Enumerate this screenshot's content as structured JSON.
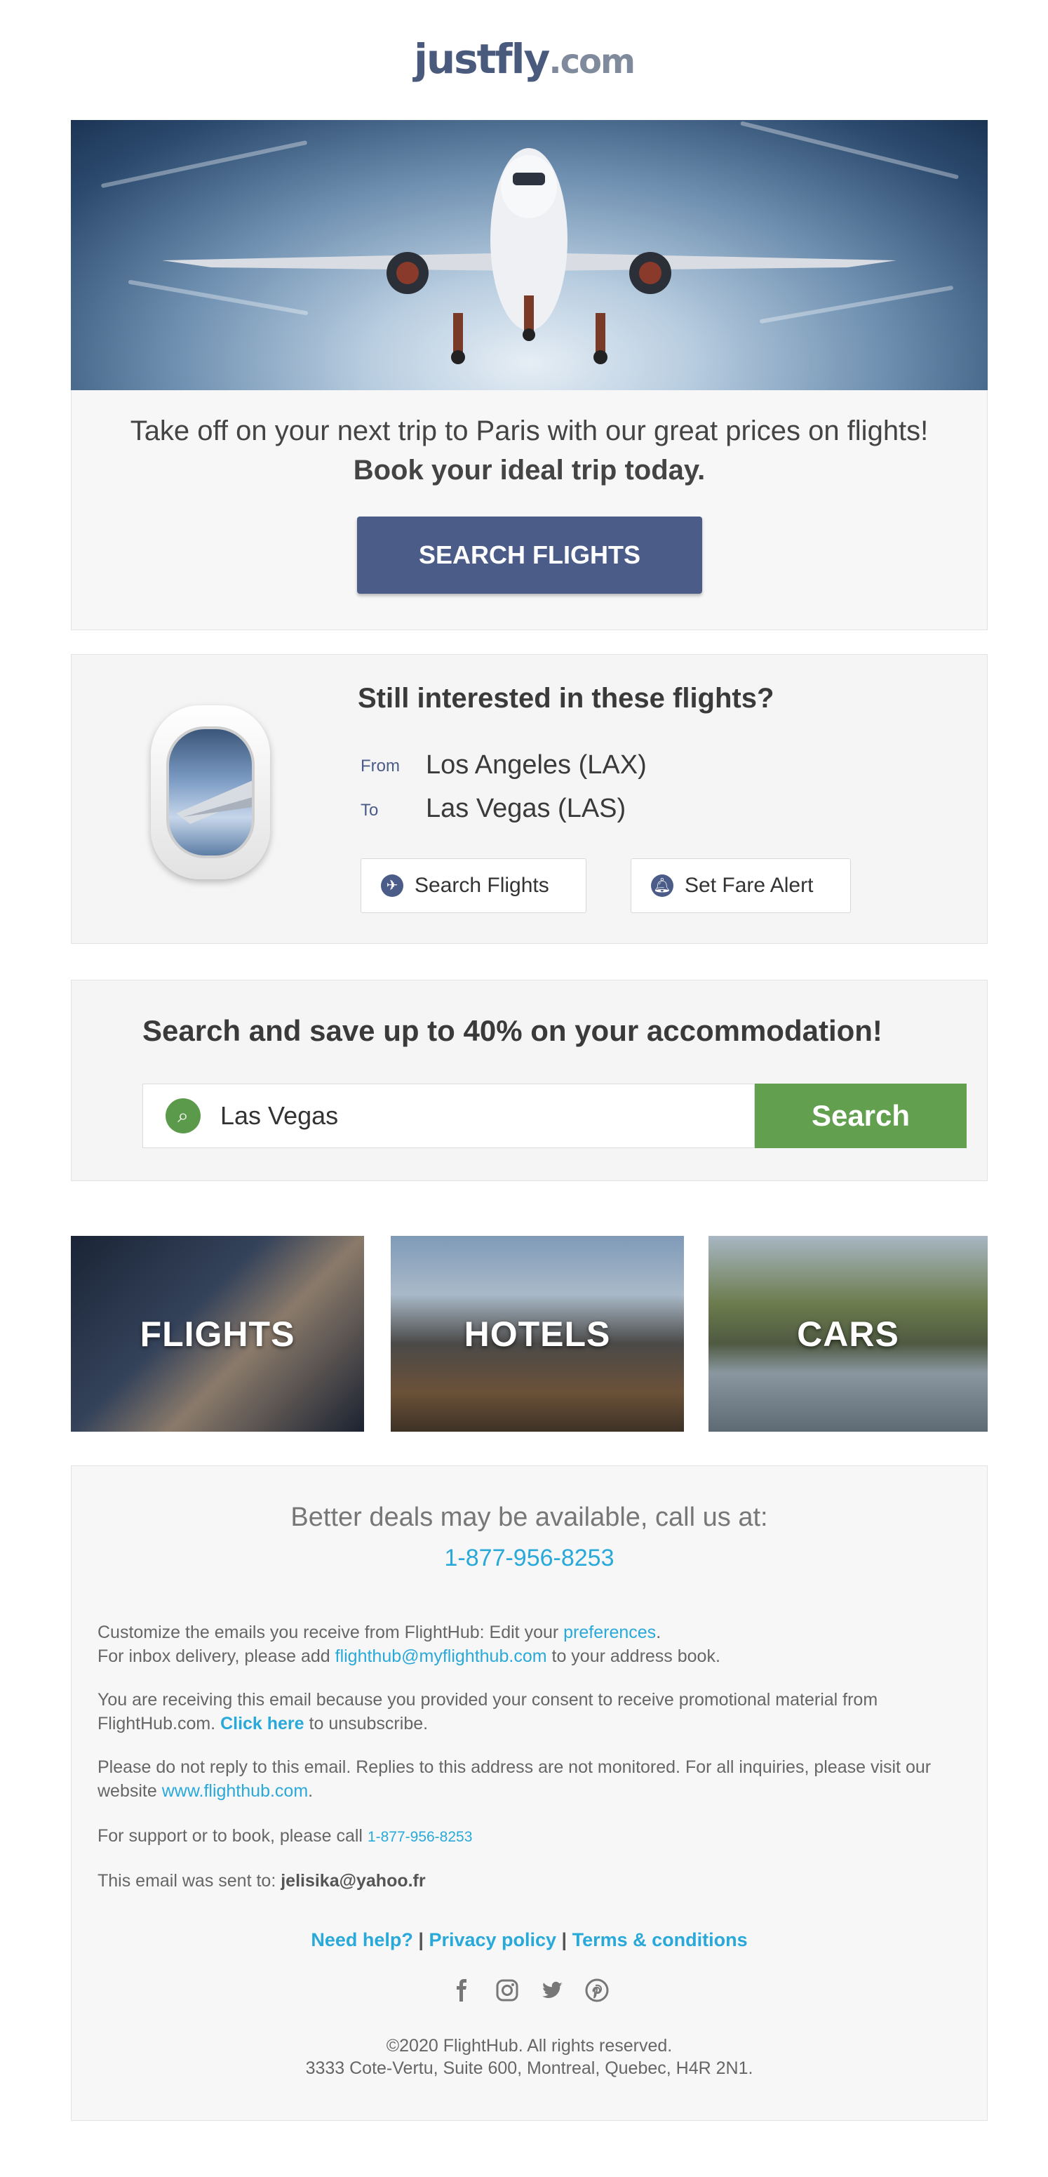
{
  "logo": {
    "part1": "just",
    "part2": "fly",
    "part3": ".com"
  },
  "hero": {
    "line1": "Take off on your next trip to Paris with our great prices on flights!",
    "line2": "Book your ideal trip today.",
    "button": "SEARCH FLIGHTS"
  },
  "interest": {
    "heading": "Still interested in these flights?",
    "from_label": "From",
    "from_value": "Los Angeles (LAX)",
    "to_label": "To",
    "to_value": "Las Vegas (LAS)",
    "search_btn": "Search Flights",
    "alert_btn": "Set Fare Alert"
  },
  "accommodation": {
    "heading": "Search and save up to 40% on your accommodation!",
    "input_value": "Las Vegas",
    "button": "Search"
  },
  "tiles": {
    "flights": "FLIGHTS",
    "hotels": "HOTELS",
    "cars": "CARS"
  },
  "footer": {
    "call_text": "Better deals may be available, call us at:",
    "phone": "1-877-956-8253",
    "p1a": "Customize the emails you receive from FlightHub: Edit your ",
    "p1_link": "preferences",
    "p1b": ".",
    "p1c": "For inbox delivery, please add ",
    "p1_email_link": "flighthub@myflighthub.com",
    "p1d": " to your address book.",
    "p2a": "You are receiving this email because you provided your consent to receive promotional material from FlightHub.com. ",
    "p2_link": "Click here",
    "p2b": " to unsubscribe.",
    "p3a": "Please do not reply to this email. Replies to this address are not monitored. For all inquiries, please visit our website ",
    "p3_link": "www.flighthub.com",
    "p3b": ".",
    "p4a": "For support or to book, please call ",
    "p4_link": "1-877-956-8253",
    "p5a": "This email was sent to: ",
    "p5_email": "jelisika@yahoo.fr",
    "link_help": "Need help?",
    "link_privacy": "Privacy policy",
    "link_terms": "Terms & conditions",
    "sep": " | ",
    "copyright": "©2020 FlightHub. All rights reserved.",
    "address": "3333 Cote-Vertu, Suite 600, Montreal, Quebec, H4R 2N1."
  },
  "icons": [
    "facebook-icon",
    "instagram-icon",
    "twitter-icon",
    "pinterest-icon"
  ],
  "colors": {
    "brand": "#4a5c87",
    "green": "#62a04f",
    "link": "#29a9d9"
  }
}
